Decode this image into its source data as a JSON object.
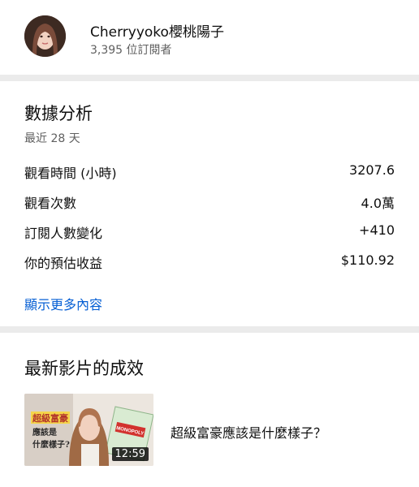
{
  "channel": {
    "name": "Cherryyoko櫻桃陽子",
    "subscribers": "3,395 位訂閱者"
  },
  "analytics": {
    "title": "數據分析",
    "period": "最近 28 天",
    "metrics": [
      {
        "label": "觀看時間 (小時)",
        "value": "3207.6"
      },
      {
        "label": "觀看次數",
        "value": "4.0萬"
      },
      {
        "label": "訂閱人數變化",
        "value": "+410"
      },
      {
        "label": "你的預估收益",
        "value": "$110.92"
      }
    ],
    "more_link": "顯示更多內容"
  },
  "latest": {
    "title": "最新影片的成效",
    "video": {
      "title": "超級富豪應該是什麼樣子？",
      "duration": "12:59",
      "thumb_text_line1": "超級富豪",
      "thumb_text_line2": "應該是",
      "thumb_text_line3": "什麼樣子?",
      "thumb_logo": "MONOPOLY"
    }
  },
  "colors": {
    "link": "#065fd4",
    "separator": "#ebebeb",
    "secondary_text": "#606060"
  }
}
